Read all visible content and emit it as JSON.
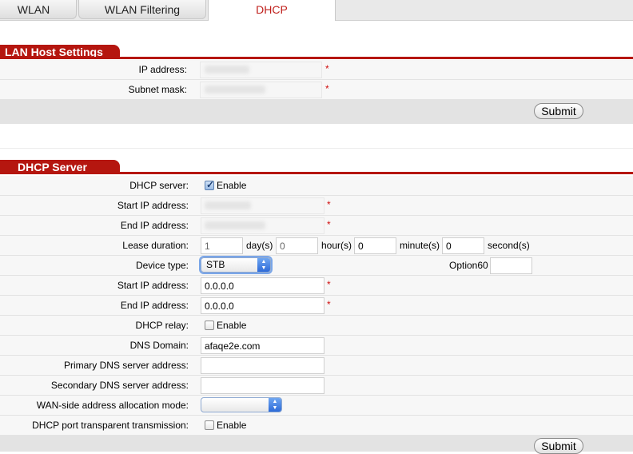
{
  "tabs": [
    {
      "label": "WLAN",
      "active": false
    },
    {
      "label": "WLAN Filtering",
      "active": false
    },
    {
      "label": "DHCP",
      "active": true
    }
  ],
  "colors": {
    "accent": "#b5160f",
    "active_tab_text": "#c0211d",
    "required": "#d01010"
  },
  "lan": {
    "title": "LAN Host Settings",
    "ip_label": "IP address:",
    "mask_label": "Subnet mask:",
    "required_mark": "*",
    "submit": "Submit"
  },
  "dhcp": {
    "title": "DHCP Server",
    "server_label": "DHCP server:",
    "server_enable": "Enable",
    "server_checked": true,
    "start_label": "Start IP address:",
    "end_label": "End IP address:",
    "lease_label": "Lease duration:",
    "lease": {
      "days": "1",
      "days_unit": "day(s)",
      "hours": "0",
      "hours_unit": "hour(s)",
      "minutes": "0",
      "minutes_unit": "minute(s)",
      "seconds": "0",
      "seconds_unit": "second(s)"
    },
    "device_type_label": "Device type:",
    "device_type_value": "STB",
    "option60_label": "Option60",
    "option60_value": "",
    "stb_start_label": "Start IP address:",
    "stb_start_value": "0.0.0.0",
    "stb_end_label": "End IP address:",
    "stb_end_value": "0.0.0.0",
    "relay_label": "DHCP relay:",
    "relay_enable": "Enable",
    "relay_checked": false,
    "dns_domain_label": "DNS Domain:",
    "dns_domain_value": "afaqe2e.com",
    "primary_dns_label": "Primary DNS server address:",
    "primary_dns_value": "",
    "secondary_dns_label": "Secondary DNS server address:",
    "secondary_dns_value": "",
    "wan_mode_label": "WAN-side address allocation mode:",
    "wan_mode_value": "",
    "port_transparent_label": "DHCP port transparent transmission:",
    "port_transparent_enable": "Enable",
    "port_transparent_checked": false,
    "required_mark": "*",
    "submit": "Submit"
  }
}
